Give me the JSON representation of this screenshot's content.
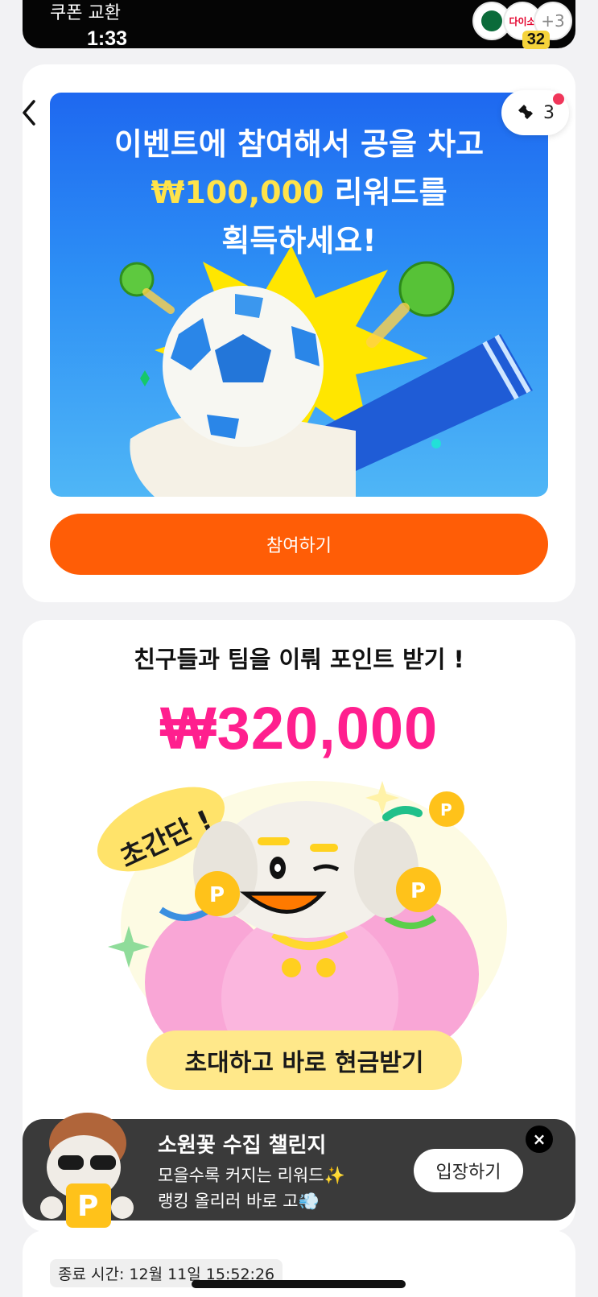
{
  "status": {
    "time": "1:33",
    "battery": "32"
  },
  "top": {
    "coupon_label": "쿠폰 교환",
    "brands": [
      "Starbucks",
      "다이소"
    ],
    "more_label": "+3"
  },
  "event": {
    "title_line1": "이벤트에 참여해서 공을 차고",
    "title_amount": "₩100,000",
    "title_line2_rest": " 리워드를",
    "title_line3": "획득하세요!",
    "ticket_count": "3",
    "join_label": "참여하기"
  },
  "team": {
    "title": "친구들과 팀을 이뤄 포인트 받기 !",
    "amount": "₩320,000",
    "badge": "초간단 !",
    "invite_label": "초대하고 바로 현금받기"
  },
  "challenge": {
    "title": "소원꽃 수집 챌린지",
    "line1": "모을수록 커지는 리워드✨",
    "line2": "랭킹 올리러 바로 고💨",
    "enter_label": "입장하기",
    "close_label": "×"
  },
  "bottom": {
    "end_time": "종료 시간: 12월 11일 15:52:26"
  },
  "colors": {
    "accent_orange": "#ff5d06",
    "pink": "#ff1f8e",
    "banner_blue": "#2d8ff5",
    "yellow": "#ffe88a"
  },
  "icons": [
    "back-chevron-icon",
    "ticket-icon",
    "close-icon"
  ]
}
